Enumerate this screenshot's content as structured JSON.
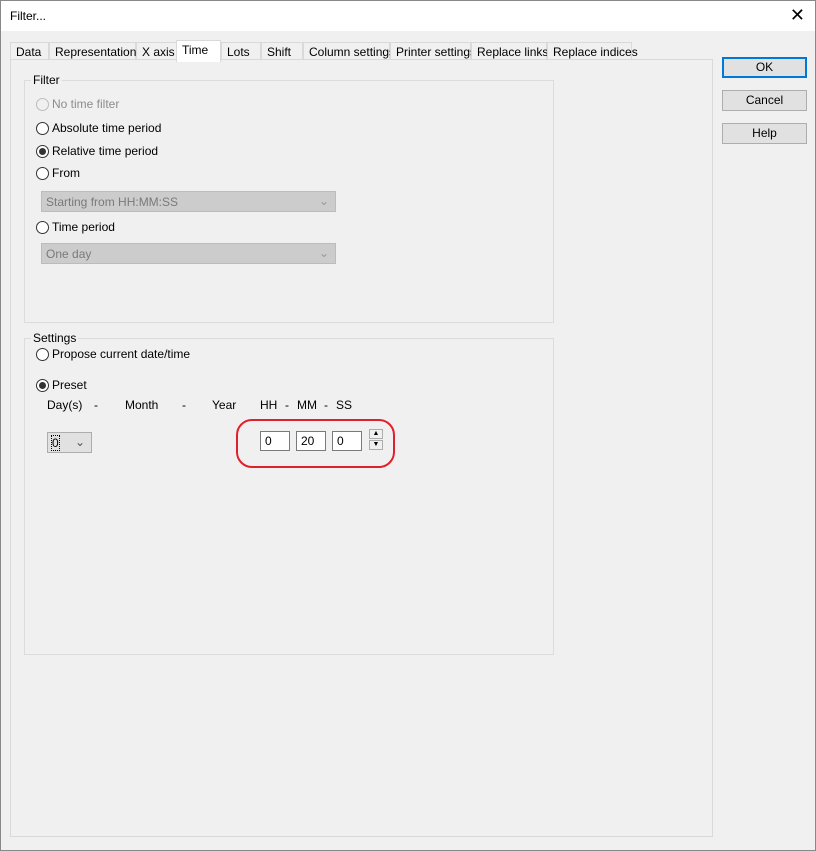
{
  "window": {
    "title": "Filter..."
  },
  "tabs": [
    "Data",
    "Representation",
    "X axis",
    "Time",
    "Lots",
    "Shift",
    "Column settings",
    "Printer settings",
    "Replace links",
    "Replace indices"
  ],
  "buttons": {
    "ok": "OK",
    "cancel": "Cancel",
    "help": "Help"
  },
  "filter": {
    "label": "Filter",
    "options": [
      "No time filter",
      "Absolute time period",
      "Relative time period",
      "From",
      "Time period"
    ],
    "from_select": "Starting from HH:MM:SS",
    "period_select": "One day"
  },
  "settings": {
    "label": "Settings",
    "propose": "Propose current date/time",
    "preset": "Preset",
    "headers": {
      "days": "Day(s)",
      "d1": "-",
      "month": "Month",
      "d2": "-",
      "year": "Year",
      "hh": "HH",
      "d3": "-",
      "mm": "MM",
      "d4": "-",
      "ss": "SS"
    },
    "day_value": "0",
    "hh_value": "0",
    "mm_value": "20",
    "ss_value": "0"
  }
}
